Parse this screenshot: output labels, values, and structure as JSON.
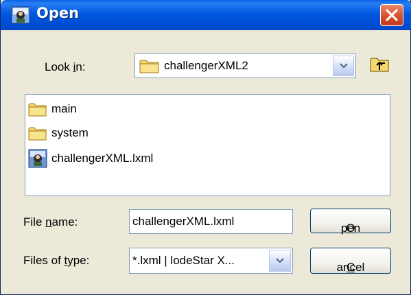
{
  "window": {
    "title": "Open",
    "title_icon": "lodestar-app-icon",
    "close_icon": "close-icon"
  },
  "look_in": {
    "label_pre": "Look ",
    "label_access": "i",
    "label_post": "n:",
    "value": "challengerXML2",
    "value_icon": "folder-icon"
  },
  "toolbar": {
    "up_icon": "up-one-level-icon"
  },
  "files": [
    {
      "name": "main",
      "icon": "folder-icon"
    },
    {
      "name": "system",
      "icon": "folder-icon"
    },
    {
      "name": "challengerXML.lxml",
      "icon": "lxml-file-icon"
    }
  ],
  "file_name": {
    "label_pre": "File ",
    "label_access": "n",
    "label_post": "ame:",
    "value": "challengerXML.lxml"
  },
  "files_of_type": {
    "label_pre": "Files of ",
    "label_access": "t",
    "label_post": "ype:",
    "value": "*.lxml | lodeStar X..."
  },
  "buttons": {
    "open_access": "O",
    "open_rest": "pen",
    "cancel_access": "C",
    "cancel_rest": "ancel"
  },
  "colors": {
    "titlebar": "#0054e3",
    "dialog_bg": "#ece9d8",
    "close_button": "#d9502a",
    "folder": "#f5d76e"
  }
}
